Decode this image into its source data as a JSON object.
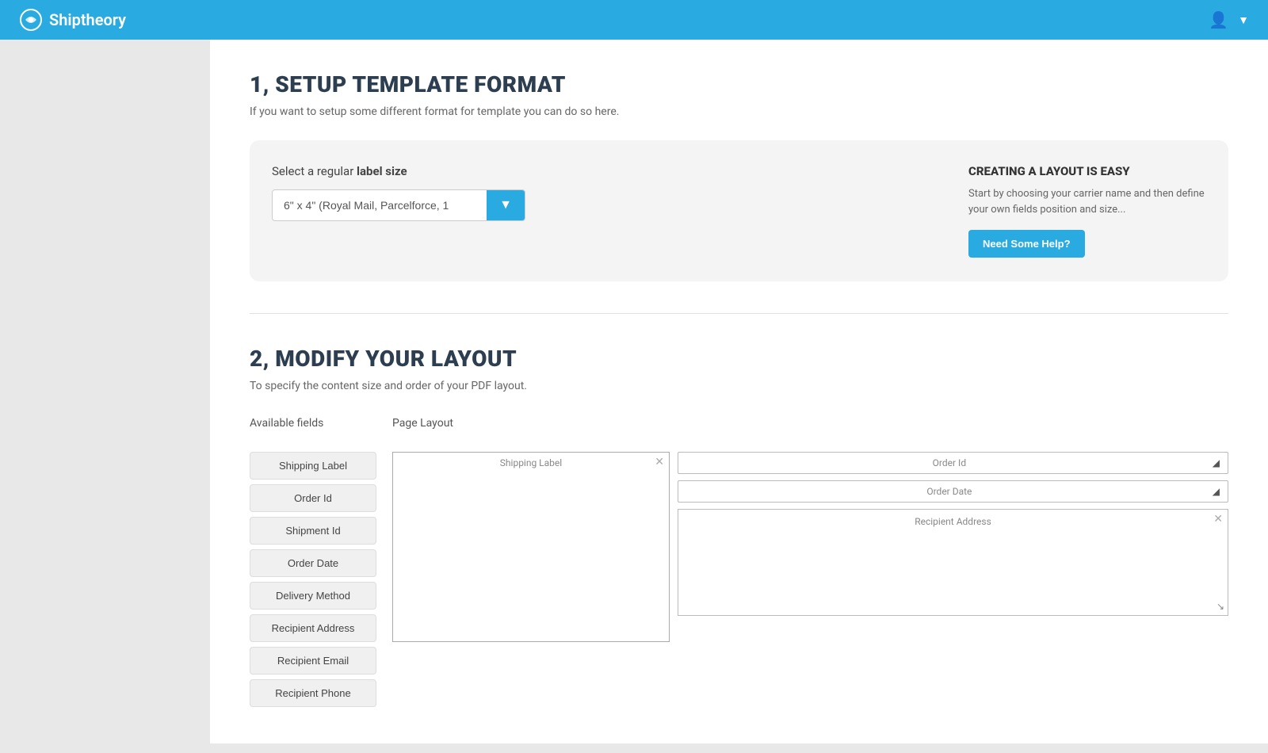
{
  "header": {
    "logo_text": "Shiptheory",
    "user_icon": "👤",
    "chevron": "▼"
  },
  "section1": {
    "title": "1, SETUP TEMPLATE FORMAT",
    "subtitle": "If you want to setup some different format for template you can do so here.",
    "label_size_label": "Select a regular",
    "label_size_bold": "label size",
    "select_value": "6\" x 4\" (Royal Mail, Parcelforce, 1",
    "help_title": "CREATING A LAYOUT IS EASY",
    "help_text": "Start by choosing your carrier name and then define your own fields position and size...",
    "help_btn_label": "Need Some Help?"
  },
  "section2": {
    "title": "2, MODIFY YOUR LAYOUT",
    "subtitle": "To specify the content size and order of your PDF layout.",
    "available_fields_header": "Available fields",
    "page_layout_header": "Page Layout",
    "available_fields": [
      "Shipping Label",
      "Order Id",
      "Shipment Id",
      "Order Date",
      "Delivery Method",
      "Recipient Address",
      "Recipient Email",
      "Recipient Phone"
    ],
    "shipping_label_box_title": "Shipping Label",
    "layout_fields": [
      "Order Id",
      "Order Date"
    ],
    "recipient_address_label": "Recipient Address"
  }
}
